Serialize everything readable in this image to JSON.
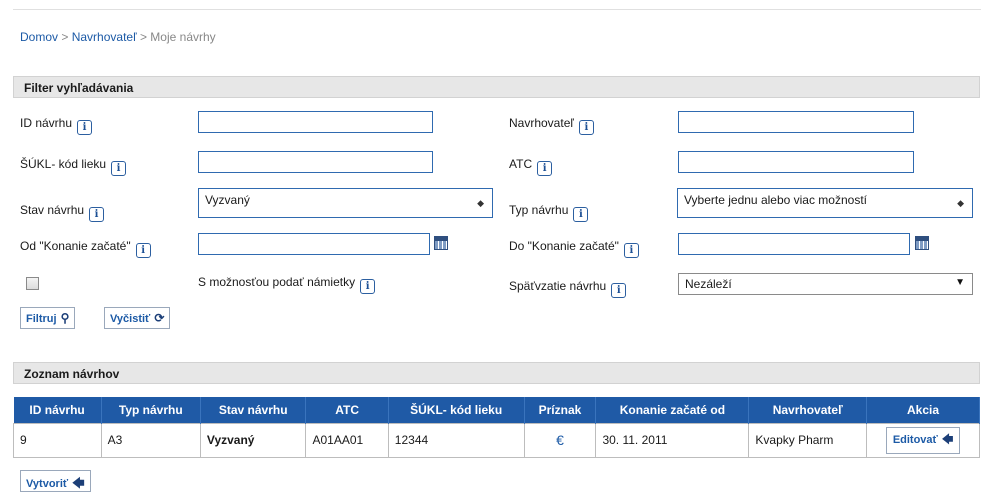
{
  "breadcrumb": {
    "home": "Domov",
    "sep": ">",
    "proposer": "Navrhovateľ",
    "current": "Moje návrhy"
  },
  "filter": {
    "title": "Filter vyhľadávania",
    "info_glyph": "i",
    "id_label": "ID návrhu",
    "id_value": "",
    "proposer_label": "Navrhovateľ",
    "proposer_value": "",
    "sukl_label": "ŠÚKL- kód lieku",
    "sukl_value": "",
    "atc_label": "ATC",
    "atc_value": "",
    "state_label": "Stav návrhu",
    "state_value": "Vyzvaný",
    "type_label": "Typ návrhu",
    "type_value": "Vyberte jednu alebo viac možností",
    "from_label": "Od \"Konanie začaté\"",
    "from_value": "",
    "to_label": "Do \"Konanie začaté\"",
    "to_value": "",
    "objection_label": "S možnosťou podať námietky",
    "withdraw_label": "Späťvzatie návrhu",
    "withdraw_value": "Nezáleží",
    "filter_button": "Filtruj",
    "clear_button": "Vyčistiť"
  },
  "list": {
    "title": "Zoznam návrhov",
    "columns": [
      "ID návrhu",
      "Typ návrhu",
      "Stav návrhu",
      "ATC",
      "ŠÚKL- kód lieku",
      "Príznak",
      "Konanie začaté od",
      "Navrhovateľ",
      "Akcia"
    ],
    "rows": [
      {
        "id": "9",
        "type": "A3",
        "state": "Vyzvaný",
        "atc": "A01AA01",
        "sukl": "12344",
        "flag": "€",
        "started": "30. 11. 2011",
        "proposer": "Kvapky Pharm",
        "action": "Editovať"
      }
    ],
    "create_button": "Vytvoriť"
  },
  "icons": {
    "search": "search-icon",
    "reset": "reset-icon",
    "arrow": "arrow-left-icon",
    "calendar": "calendar-icon"
  },
  "colors": {
    "accent": "#1f5aa6",
    "link": "#1c5aa6"
  }
}
